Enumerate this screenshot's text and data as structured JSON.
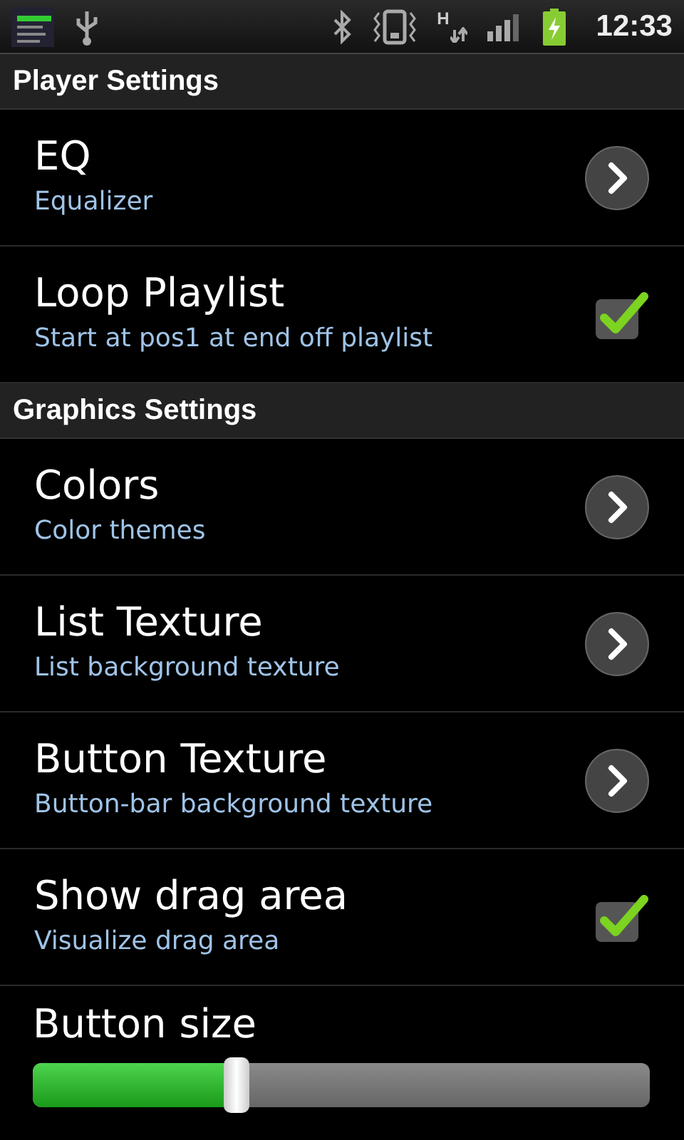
{
  "status_bar": {
    "network": "H",
    "time": "12:33"
  },
  "sections": [
    {
      "header": "Player Settings",
      "items": [
        {
          "kind": "nav",
          "title": "EQ",
          "summary": "Equalizer"
        },
        {
          "kind": "checkbox",
          "title": "Loop Playlist",
          "summary": "Start at pos1 at end off playlist",
          "checked": true
        }
      ]
    },
    {
      "header": "Graphics Settings",
      "items": [
        {
          "kind": "nav",
          "title": "Colors",
          "summary": "Color themes"
        },
        {
          "kind": "nav",
          "title": "List Texture",
          "summary": "List background texture"
        },
        {
          "kind": "nav",
          "title": "Button Texture",
          "summary": "Button-bar background texture"
        },
        {
          "kind": "checkbox",
          "title": "Show drag area",
          "summary": "Visualize drag area",
          "checked": true
        },
        {
          "kind": "slider",
          "title": "Button size",
          "level": 0.33
        }
      ]
    }
  ]
}
